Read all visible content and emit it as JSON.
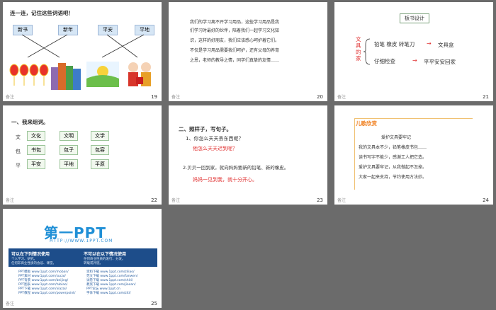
{
  "slides": [
    {
      "num": "19",
      "title": "连一连，记住这些词语吧！",
      "boxes": [
        "新书",
        "新年",
        "平安",
        "平地"
      ]
    },
    {
      "num": "20",
      "paragraph": [
        "我们的学习离不开学习用品，这些学习用品是我",
        "们学习时最好的伙伴，陪着我们一起学习文化知",
        "识，这样的好朋友，我们应该感心呵护着它们。",
        "不仅是学习用品需要我们呵护，还有父母的养育",
        "之恩，老师的教导之情，同学们真挚的友情……"
      ]
    },
    {
      "num": "21",
      "header": "板书设计",
      "left_text": "文具的家",
      "row1": "铅笔 橡皮 转笔刀",
      "row1_result": "文具盒",
      "row2": "仔细检查",
      "row2_result": "平平安安回家"
    },
    {
      "num": "22",
      "title": "一、我来组词。",
      "rows": [
        {
          "char": "文",
          "words": [
            "文化",
            "文明",
            "文学"
          ]
        },
        {
          "char": "包",
          "words": [
            "书包",
            "包子",
            "包容"
          ]
        },
        {
          "char": "平",
          "words": [
            "平安",
            "平地",
            "平原"
          ]
        }
      ]
    },
    {
      "num": "23",
      "title": "二、照样子，写句子。",
      "q1": "1、你怎么天天丢东西呢？",
      "a1": "他怎么天天迟到呢？",
      "q2": "2.贝贝一回到家，就向妈妈要新的铅笔、新的橡皮。",
      "a2": "妈妈一见到我，就十分开心。"
    },
    {
      "num": "24",
      "header": "儿歌欣赏",
      "lines": [
        "爱护文具要牢记",
        "我的文具本不少，铅笔橡皮书包……",
        "读书写字不能少，感谢工人把它造。",
        "爱护文具要牢记，从我做起不怎掉。",
        "大家一起来支持，节约使用方法妙。"
      ]
    },
    {
      "num": "25",
      "logo": "第一PPT",
      "url": "HTTP://WWW.1PPT.COM",
      "left_head": "可以在下列情况使用",
      "right_head": "不可以在以下情况使用",
      "left_sub": [
        "个人学习、研究。",
        "任何非商业性质的会议、课堂。"
      ],
      "right_sub": [
        "任何商业性质的发行、分发。",
        "转载或外链。"
      ],
      "links": [
        "PPT模板 www.1ppt.com/moban/",
        "PPT素材 www.1ppt.com/sucai/",
        "PPT背景 www.1ppt.com/beijing/",
        "PPT图表 www.1ppt.com/tubiao/",
        "PPT下载 www.1ppt.com/xiazai/",
        "PPT教程 www.1ppt.com/powerpoint/"
      ],
      "links2": [
        "资料下载 www.1ppt.com/ziliao/",
        "范文下载 www.1ppt.com/fanwen/",
        "试卷下载 www.1ppt.com/shiti/",
        "教案下载 www.1ppt.com/jiaoan/",
        "PPT论坛 www.1ppt.cn",
        "字体下载 www.1ppt.com/ziti/"
      ]
    }
  ],
  "note_label": "备注"
}
